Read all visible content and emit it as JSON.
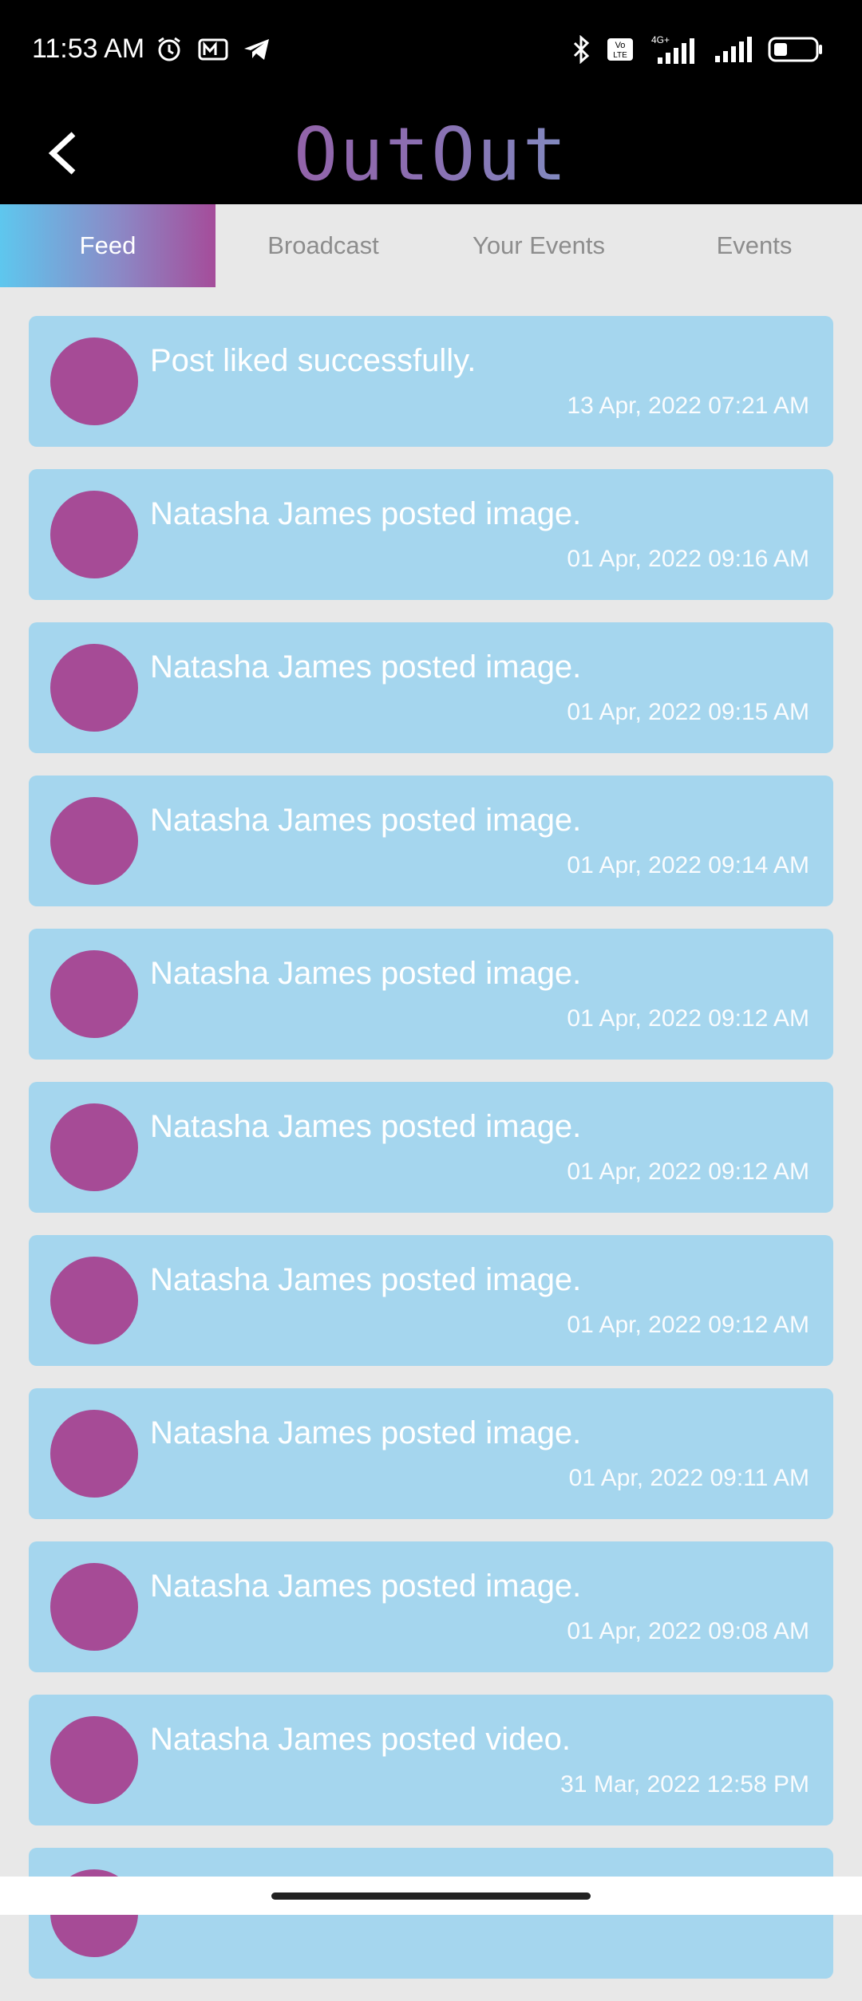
{
  "status": {
    "time": "11:53 AM",
    "network": "4G+",
    "volte": "Vo LTE"
  },
  "app": {
    "logo": "OutOut"
  },
  "tabs": [
    {
      "label": "Feed",
      "active": true
    },
    {
      "label": "Broadcast",
      "active": false
    },
    {
      "label": "Your Events",
      "active": false
    },
    {
      "label": "Events",
      "active": false
    }
  ],
  "feed": [
    {
      "text": "Post liked successfully.",
      "time": "13 Apr, 2022 07:21 AM"
    },
    {
      "text": "Natasha James posted image.",
      "time": "01 Apr, 2022 09:16 AM"
    },
    {
      "text": "Natasha James posted image.",
      "time": "01 Apr, 2022 09:15 AM"
    },
    {
      "text": "Natasha James posted image.",
      "time": "01 Apr, 2022 09:14 AM"
    },
    {
      "text": "Natasha James posted image.",
      "time": "01 Apr, 2022 09:12 AM"
    },
    {
      "text": "Natasha James posted image.",
      "time": "01 Apr, 2022 09:12 AM"
    },
    {
      "text": "Natasha James posted image.",
      "time": "01 Apr, 2022 09:12 AM"
    },
    {
      "text": "Natasha James posted image.",
      "time": "01 Apr, 2022 09:11 AM"
    },
    {
      "text": "Natasha James posted image.",
      "time": "01 Apr, 2022 09:08 AM"
    },
    {
      "text": "Natasha James posted video.",
      "time": "31 Mar, 2022 12:58 PM"
    }
  ],
  "colors": {
    "card": "#a5d6ee",
    "avatar": "#a64b96",
    "tab_gradient_start": "#5ec7ee",
    "tab_gradient_end": "#a54c9a"
  }
}
